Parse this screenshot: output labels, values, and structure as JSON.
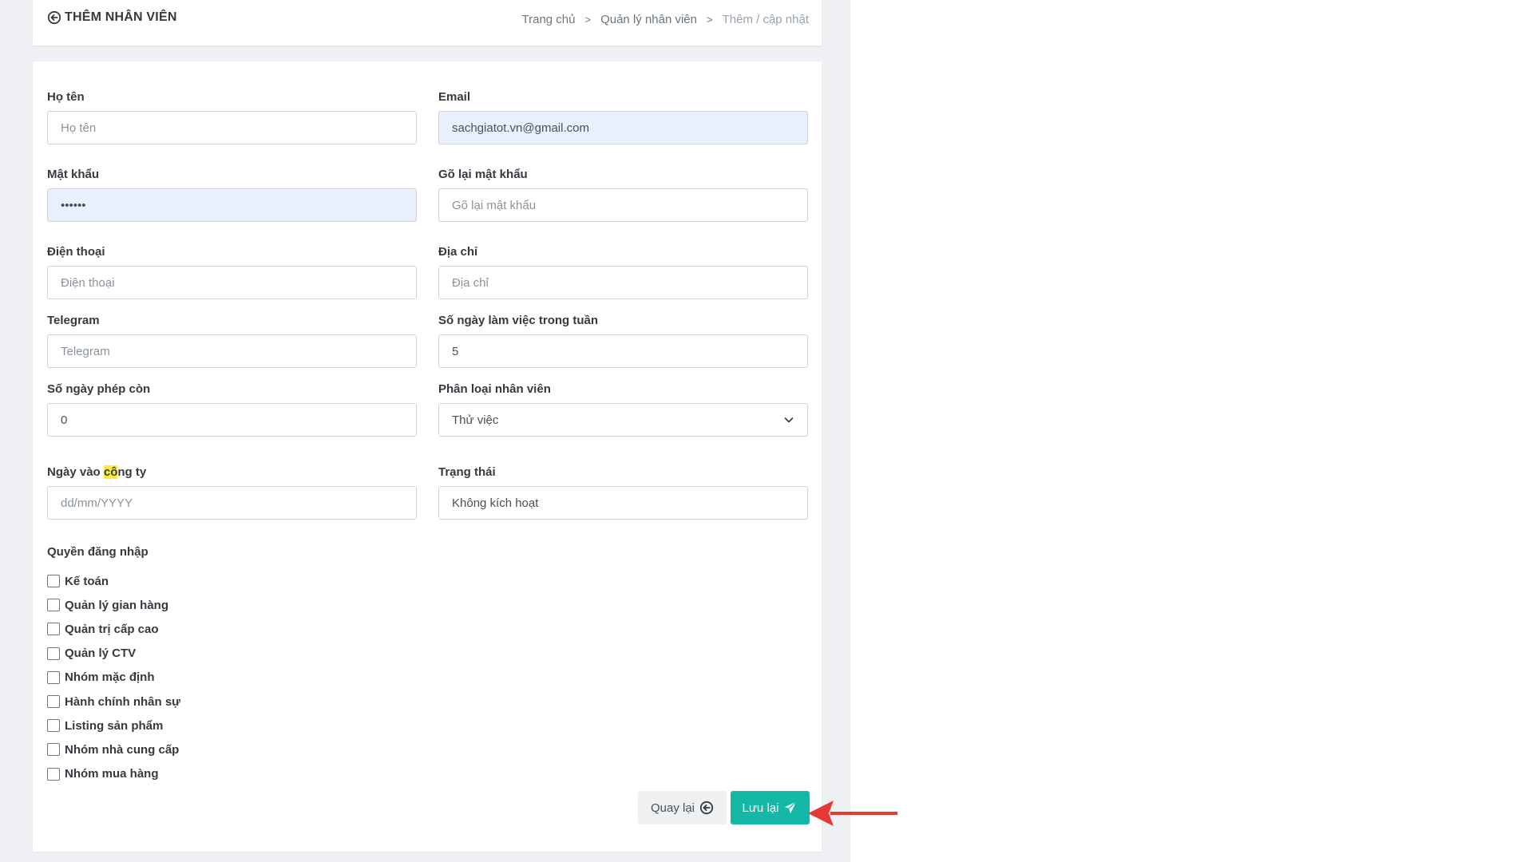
{
  "header": {
    "title": "THÊM NHÂN VIÊN",
    "breadcrumb": [
      "Trang chủ",
      "Quản lý nhân viên",
      "Thêm / cập nhật"
    ]
  },
  "form": {
    "ho_ten": {
      "label": "Họ tên",
      "placeholder": "Họ tên",
      "value": ""
    },
    "email": {
      "label": "Email",
      "value": "sachgiatot.vn@gmail.com"
    },
    "mat_khau": {
      "label": "Mật khẩu",
      "value": "••••••"
    },
    "go_lai_mat_khau": {
      "label": "Gõ lại mật khẩu",
      "placeholder": "Gõ lại mật khẩu"
    },
    "dien_thoai": {
      "label": "Điện thoại",
      "placeholder": "Điện thoại"
    },
    "dia_chi": {
      "label": "Địa chỉ",
      "placeholder": "Địa chỉ"
    },
    "telegram": {
      "label": "Telegram",
      "placeholder": "Telegram"
    },
    "so_ngay_lam_viec": {
      "label": "Số ngày làm việc trong tuần",
      "value": "5"
    },
    "so_ngay_phep": {
      "label": "Số ngày phép còn",
      "value": "0"
    },
    "phan_loai": {
      "label": "Phân loại nhân viên",
      "value": "Thử việc"
    },
    "ngay_vao_cong_ty": {
      "label_before": "Ngày vào ",
      "label_highlight": "cô",
      "label_after": "ng ty",
      "placeholder": "dd/mm/YYYY"
    },
    "trang_thai": {
      "label": "Trạng thái",
      "value": "Không kích hoạt"
    }
  },
  "permissions": {
    "title": "Quyền đăng nhập",
    "items": [
      "Kế toán",
      "Quản lý gian hàng",
      "Quản trị cấp cao",
      "Quản lý CTV",
      "Nhóm mặc định",
      "Hành chính nhân sự",
      "Listing sản phẩm",
      "Nhóm nhà cung cấp",
      "Nhóm mua hàng"
    ]
  },
  "buttons": {
    "back": "Quay lại",
    "save": "Lưu lại"
  },
  "colors": {
    "accent": "#14b8a6",
    "annotation_arrow": "#e53935",
    "autofill": "#e8f0fe"
  }
}
